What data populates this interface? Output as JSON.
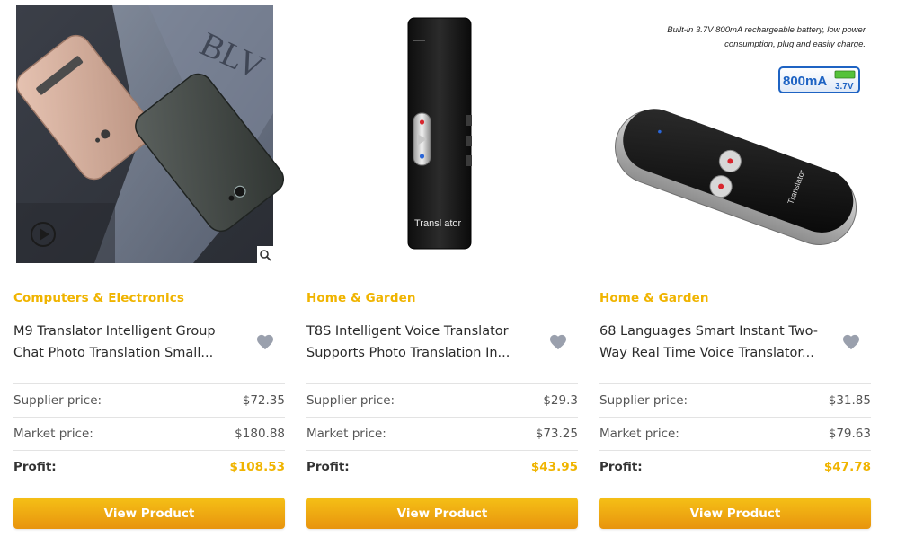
{
  "theme": {
    "accent": "#f0b400",
    "button_top": "#f5c016",
    "button_bottom": "#e8940e"
  },
  "labels": {
    "supplier_price": "Supplier price:",
    "market_price": "Market price:",
    "profit": "Profit:",
    "view_product": "View Product"
  },
  "products": [
    {
      "category": "Computers & Electronics",
      "title": "M9 Translator Intelligent Group Chat Photo Translation Small...",
      "supplier_price": "$72.35",
      "market_price": "$180.88",
      "profit": "$108.53",
      "image_text": "BLV"
    },
    {
      "category": "Home & Garden",
      "title": "T8S Intelligent Voice Translator Supports Photo Translation In...",
      "supplier_price": "$29.3",
      "market_price": "$73.25",
      "profit": "$43.95",
      "image_text": "Transl ator"
    },
    {
      "category": "Home & Garden",
      "title": "68 Languages Smart Instant Two-Way Real Time Voice Translator...",
      "supplier_price": "$31.85",
      "market_price": "$79.63",
      "profit": "$47.78",
      "image_caption_line1": "Built-in 3.7V 800mA rechargeable battery, low power",
      "image_caption_line2": "consumption, plug and easily charge.",
      "badge_capacity": "800mA",
      "badge_voltage": "3.7V",
      "device_text": "Translator"
    }
  ]
}
